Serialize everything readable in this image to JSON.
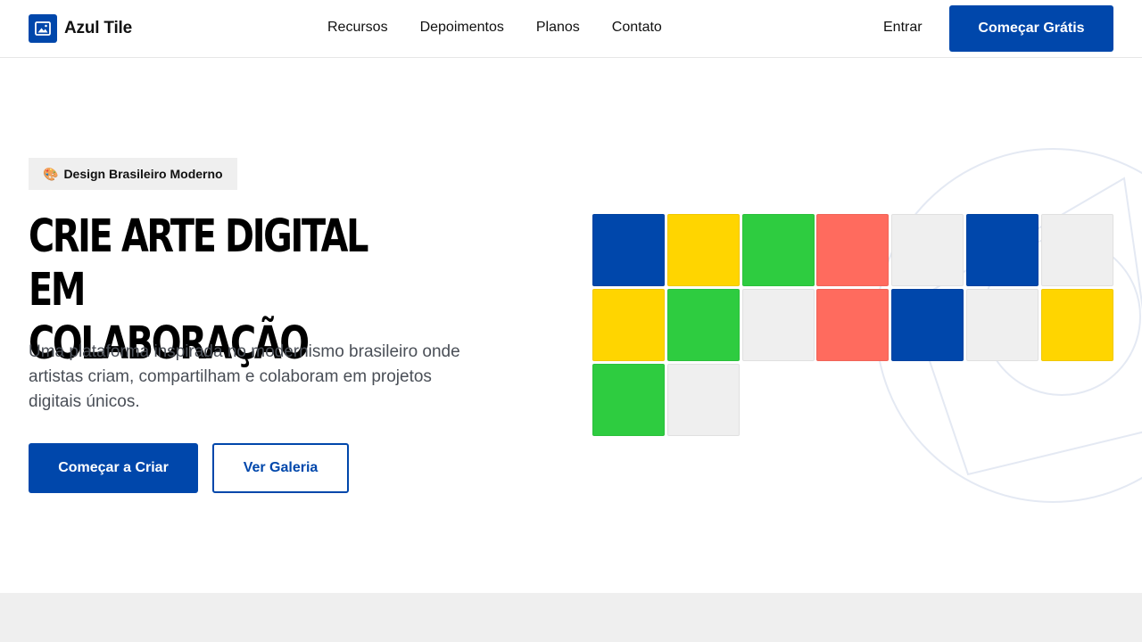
{
  "header": {
    "brand_name": "Azul Tile",
    "nav": [
      "Recursos",
      "Depoimentos",
      "Planos",
      "Contato"
    ],
    "login_label": "Entrar",
    "cta_label": "Começar Grátis"
  },
  "hero": {
    "badge_emoji": "🎨",
    "badge_label": "Design Brasileiro Moderno",
    "headline_line1": "Crie Arte Digital em",
    "headline_line2": "Colaboração",
    "description": "Uma plataforma inspirada no modernismo brasileiro onde artistas criam, compartilham e colaboram em projetos digitais únicos.",
    "primary_button": "Começar a Criar",
    "secondary_button": "Ver Galeria"
  },
  "tiles": [
    "blue",
    "yellow",
    "green",
    "coral",
    "light",
    "blue",
    "light",
    "yellow",
    "green",
    "light",
    "coral",
    "blue",
    "light",
    "yellow",
    "green",
    "light"
  ],
  "colors": {
    "accent": "#0047ab",
    "blue": "#0047ab",
    "yellow": "#ffd500",
    "green": "#2ecc40",
    "coral": "#ff6b5e",
    "light": "#efefef",
    "text_muted": "#4a4f57"
  },
  "icons": {
    "brand": "image-icon"
  }
}
